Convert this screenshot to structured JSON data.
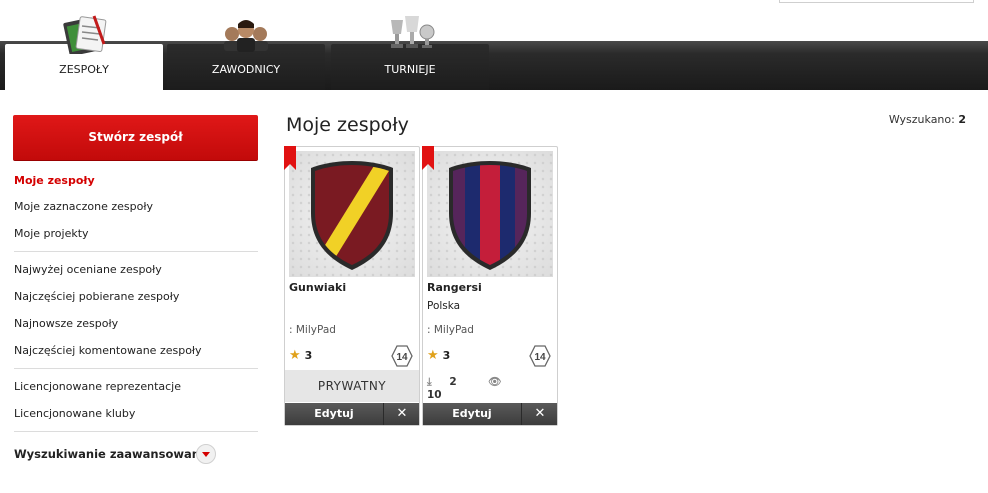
{
  "nav": {
    "tabs": [
      {
        "label": "ZESPOŁY",
        "icon": "tactics-board-icon"
      },
      {
        "label": "ZAWODNICY",
        "icon": "players-icon"
      },
      {
        "label": "TURNIEJE",
        "icon": "trophies-icon"
      }
    ]
  },
  "sidebar": {
    "create_label": "Stwórz zespół",
    "group1": [
      "Moje zespoły",
      "Moje zaznaczone zespoły",
      "Moje projekty"
    ],
    "group2": [
      "Najwyżej oceniane zespoły",
      "Najczęściej pobierane zespoły",
      "Najnowsze zespoły",
      "Najczęściej komentowane zespoły"
    ],
    "group3": [
      "Licencjonowane reprezentacje",
      "Licencjonowane kluby"
    ],
    "advanced_label": "Wyszukiwanie zaawansowane"
  },
  "main": {
    "title": "Moje zespoły",
    "found_label": "Wyszukano:",
    "found_count": "2",
    "cards": [
      {
        "name": "Gunwiaki",
        "country": "",
        "author": ": MilyPad",
        "rating": "3",
        "age": "14",
        "status": "PRYWATNY",
        "edit_label": "Edytuj",
        "close_label": "✕",
        "crest_colors": [
          "#7a1a22",
          "#f1d126"
        ]
      },
      {
        "name": "Rangersi",
        "country": "Polska",
        "author": ": MilyPad",
        "rating": "3",
        "age": "14",
        "downloads": "2",
        "views": "10",
        "edit_label": "Edytuj",
        "close_label": "✕",
        "crest_colors": [
          "#1d2a6e",
          "#c41e3a"
        ]
      }
    ]
  }
}
